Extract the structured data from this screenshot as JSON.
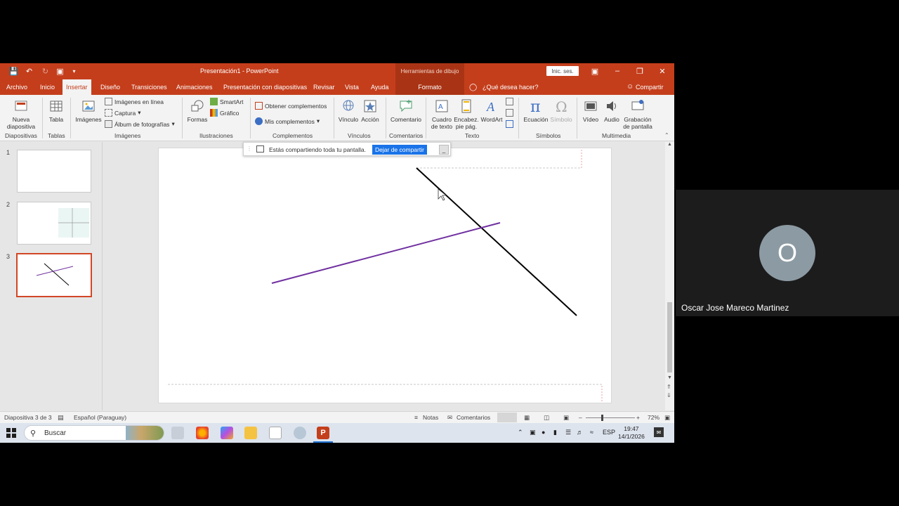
{
  "window": {
    "title": "Presentación1  -  PowerPoint",
    "context_tools": "Herramientas de dibujo",
    "signin": "Inic. ses."
  },
  "tabs": {
    "archivo": "Archivo",
    "inicio": "Inicio",
    "insertar": "Insertar",
    "diseno": "Diseño",
    "transiciones": "Transiciones",
    "animaciones": "Animaciones",
    "presentacion": "Presentación con diapositivas",
    "revisar": "Revisar",
    "vista": "Vista",
    "ayuda": "Ayuda",
    "formato": "Formato",
    "search": "¿Qué desea hacer?",
    "share": "Compartir"
  },
  "ribbon": {
    "nueva_diapositiva_1": "Nueva",
    "nueva_diapositiva_2": "diapositiva",
    "tabla": "Tabla",
    "imagenes": "Imágenes",
    "imagenes_en_linea": "Imágenes en línea",
    "captura": "Captura",
    "album": "Álbum de fotografías",
    "formas": "Formas",
    "smartart": "SmartArt",
    "grafico": "Gráfico",
    "obtener_complementos": "Obtener complementos",
    "mis_complementos": "Mis complementos",
    "vinculo": "Vínculo",
    "accion": "Acción",
    "comentario": "Comentario",
    "cuadro_texto_1": "Cuadro",
    "cuadro_texto_2": "de texto",
    "encabez_1": "Encabez.",
    "encabez_2": "pie pág.",
    "wordart": "WordArt",
    "ecuacion": "Ecuación",
    "simbolo": "Símbolo",
    "video": "Vídeo",
    "audio": "Audio",
    "grabacion_1": "Grabación",
    "grabacion_2": "de pantalla",
    "groups": {
      "diapositivas": "Diapositivas",
      "tablas": "Tablas",
      "imagenes": "Imágenes",
      "ilustraciones": "Ilustraciones",
      "complementos": "Complementos",
      "vinculos": "Vínculos",
      "comentarios": "Comentarios",
      "texto": "Texto",
      "simbolos": "Símbolos",
      "multimedia": "Multimedia"
    }
  },
  "sharebar": {
    "text": "Estás compartiendo toda tu pantalla.",
    "stop": "Dejar de compartir",
    "minimize": "_"
  },
  "slides": {
    "numbers": [
      "1",
      "2",
      "3"
    ],
    "selected": 3
  },
  "statusbar": {
    "slide_info": "Diapositiva 3 de 3",
    "language": "Español (Paraguay)",
    "notas": "Notas",
    "comentarios": "Comentarios",
    "zoom": "72%"
  },
  "taskbar": {
    "search": "Buscar",
    "lang": "ESP",
    "time": "19:47",
    "date": "14/1/2026"
  },
  "meeting": {
    "avatar_letter": "O",
    "participant_name": "Oscar Jose Mareco Martinez"
  },
  "colors": {
    "ppt_accent": "#c43e1c",
    "purple_line": "#7030a0",
    "black_line": "#000000",
    "share_button": "#1a73e8"
  }
}
